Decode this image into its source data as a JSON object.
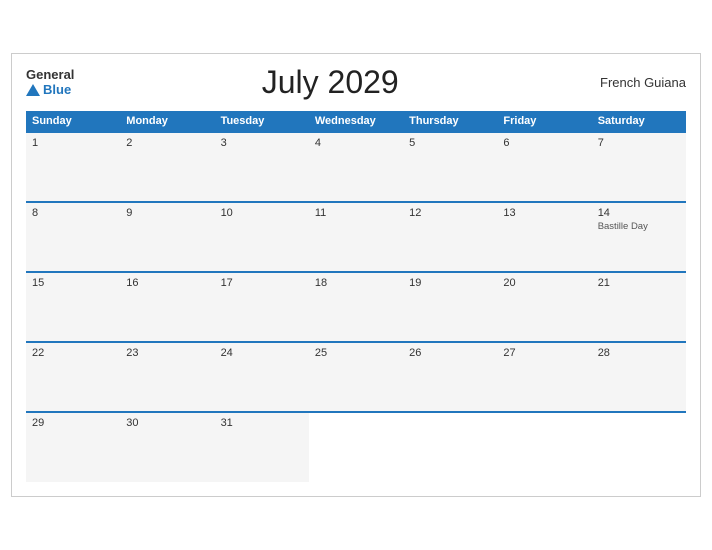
{
  "header": {
    "logo_general": "General",
    "logo_blue": "Blue",
    "title": "July 2029",
    "region": "French Guiana"
  },
  "days_of_week": [
    "Sunday",
    "Monday",
    "Tuesday",
    "Wednesday",
    "Thursday",
    "Friday",
    "Saturday"
  ],
  "weeks": [
    [
      {
        "day": "1",
        "holiday": ""
      },
      {
        "day": "2",
        "holiday": ""
      },
      {
        "day": "3",
        "holiday": ""
      },
      {
        "day": "4",
        "holiday": ""
      },
      {
        "day": "5",
        "holiday": ""
      },
      {
        "day": "6",
        "holiday": ""
      },
      {
        "day": "7",
        "holiday": ""
      }
    ],
    [
      {
        "day": "8",
        "holiday": ""
      },
      {
        "day": "9",
        "holiday": ""
      },
      {
        "day": "10",
        "holiday": ""
      },
      {
        "day": "11",
        "holiday": ""
      },
      {
        "day": "12",
        "holiday": ""
      },
      {
        "day": "13",
        "holiday": ""
      },
      {
        "day": "14",
        "holiday": "Bastille Day"
      }
    ],
    [
      {
        "day": "15",
        "holiday": ""
      },
      {
        "day": "16",
        "holiday": ""
      },
      {
        "day": "17",
        "holiday": ""
      },
      {
        "day": "18",
        "holiday": ""
      },
      {
        "day": "19",
        "holiday": ""
      },
      {
        "day": "20",
        "holiday": ""
      },
      {
        "day": "21",
        "holiday": ""
      }
    ],
    [
      {
        "day": "22",
        "holiday": ""
      },
      {
        "day": "23",
        "holiday": ""
      },
      {
        "day": "24",
        "holiday": ""
      },
      {
        "day": "25",
        "holiday": ""
      },
      {
        "day": "26",
        "holiday": ""
      },
      {
        "day": "27",
        "holiday": ""
      },
      {
        "day": "28",
        "holiday": ""
      }
    ],
    [
      {
        "day": "29",
        "holiday": ""
      },
      {
        "day": "30",
        "holiday": ""
      },
      {
        "day": "31",
        "holiday": ""
      },
      {
        "day": "",
        "holiday": ""
      },
      {
        "day": "",
        "holiday": ""
      },
      {
        "day": "",
        "holiday": ""
      },
      {
        "day": "",
        "holiday": ""
      }
    ]
  ]
}
